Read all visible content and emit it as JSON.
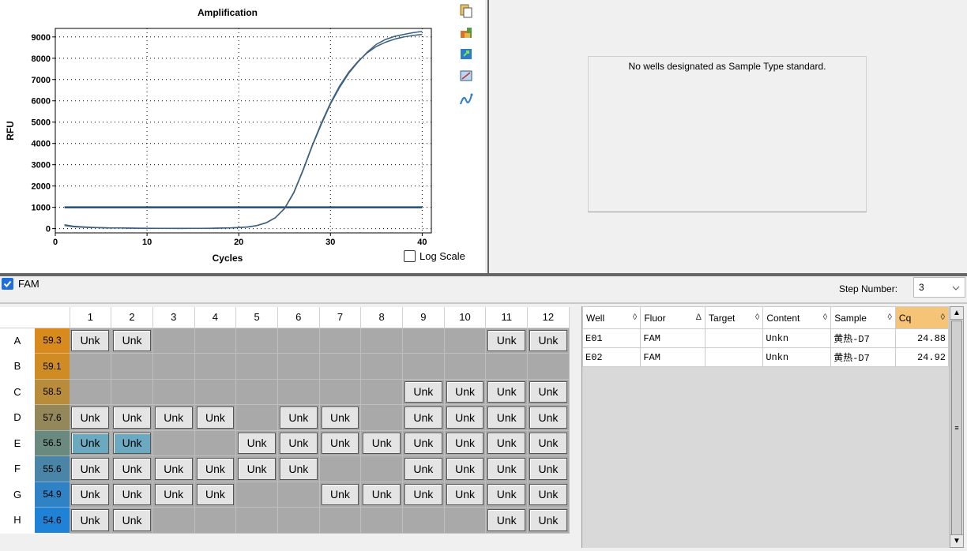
{
  "chart_data": {
    "type": "line",
    "title": "Amplification",
    "xlabel": "Cycles",
    "ylabel": "RFU",
    "xlim": [
      0,
      41
    ],
    "ylim": [
      -200,
      9400
    ],
    "xticks": [
      0,
      10,
      20,
      30,
      40
    ],
    "yticks": [
      0,
      1000,
      2000,
      3000,
      4000,
      5000,
      6000,
      7000,
      8000,
      9000
    ],
    "grid": true,
    "threshold": 1000,
    "threshold_color": "#1f4e79",
    "series_color": "#3d5f7f",
    "series": [
      {
        "x": [
          1,
          2,
          3,
          4,
          5,
          6,
          7,
          8,
          9,
          10,
          11,
          12,
          13,
          14,
          15,
          16,
          17,
          18,
          19,
          20,
          21,
          22,
          23,
          24,
          25,
          26,
          27,
          28,
          29,
          30,
          31,
          32,
          33,
          34,
          35,
          36,
          37,
          38,
          39,
          40
        ],
        "values": [
          180,
          110,
          80,
          60,
          45,
          35,
          30,
          25,
          20,
          18,
          15,
          12,
          10,
          10,
          12,
          15,
          18,
          25,
          35,
          50,
          80,
          150,
          280,
          520,
          950,
          1700,
          2750,
          3900,
          4950,
          5900,
          6700,
          7350,
          7850,
          8250,
          8550,
          8750,
          8900,
          9000,
          9070,
          9120
        ]
      },
      {
        "x": [
          1,
          2,
          3,
          4,
          5,
          6,
          7,
          8,
          9,
          10,
          11,
          12,
          13,
          14,
          15,
          16,
          17,
          18,
          19,
          20,
          21,
          22,
          23,
          24,
          25,
          26,
          27,
          28,
          29,
          30,
          31,
          32,
          33,
          34,
          35,
          36,
          37,
          38,
          39,
          40
        ],
        "values": [
          150,
          90,
          65,
          50,
          40,
          32,
          28,
          22,
          18,
          15,
          12,
          10,
          8,
          8,
          10,
          12,
          15,
          22,
          32,
          48,
          75,
          145,
          270,
          510,
          940,
          1680,
          2720,
          3870,
          4900,
          5850,
          6630,
          7300,
          7820,
          8280,
          8650,
          8880,
          9030,
          9120,
          9200,
          9260
        ]
      }
    ]
  },
  "log_scale_label": "Log Scale",
  "standard_message": "No wells designated as Sample Type standard.",
  "fluor_label": "FAM",
  "step_number_label": "Step Number:",
  "step_number_value": "3",
  "plate": {
    "columns": [
      "1",
      "2",
      "3",
      "4",
      "5",
      "6",
      "7",
      "8",
      "9",
      "10",
      "11",
      "12"
    ],
    "rows": [
      {
        "label": "A",
        "temp": "59.3",
        "temp_color": "#d98a1c",
        "wells": [
          "Unk",
          "Unk",
          "",
          "",
          "",
          "",
          "",
          "",
          "",
          "",
          "Unk",
          "Unk"
        ]
      },
      {
        "label": "B",
        "temp": "59.1",
        "temp_color": "#d08c24",
        "wells": [
          "",
          "",
          "",
          "",
          "",
          "",
          "",
          "",
          "",
          "",
          "",
          ""
        ]
      },
      {
        "label": "C",
        "temp": "58.5",
        "temp_color": "#b88c3a",
        "wells": [
          "",
          "",
          "",
          "",
          "",
          "",
          "",
          "",
          "Unk",
          "Unk",
          "Unk",
          "Unk"
        ]
      },
      {
        "label": "D",
        "temp": "57.6",
        "temp_color": "#94875a",
        "wells": [
          "Unk",
          "Unk",
          "Unk",
          "Unk",
          "",
          "Unk",
          "Unk",
          "",
          "Unk",
          "Unk",
          "Unk",
          "Unk"
        ]
      },
      {
        "label": "E",
        "temp": "56.5",
        "temp_color": "#6a8a80",
        "wells": [
          "Unk",
          "Unk",
          "",
          "",
          "Unk",
          "Unk",
          "Unk",
          "Unk",
          "Unk",
          "Unk",
          "Unk",
          "Unk"
        ]
      },
      {
        "label": "F",
        "temp": "55.6",
        "temp_color": "#4a84a6",
        "wells": [
          "Unk",
          "Unk",
          "Unk",
          "Unk",
          "Unk",
          "Unk",
          "",
          "",
          "Unk",
          "Unk",
          "Unk",
          "Unk"
        ]
      },
      {
        "label": "G",
        "temp": "54.9",
        "temp_color": "#2f82c4",
        "wells": [
          "Unk",
          "Unk",
          "Unk",
          "Unk",
          "",
          "",
          "Unk",
          "Unk",
          "Unk",
          "Unk",
          "Unk",
          "Unk"
        ]
      },
      {
        "label": "H",
        "temp": "54.6",
        "temp_color": "#1f82d6",
        "wells": [
          "Unk",
          "Unk",
          "",
          "",
          "",
          "",
          "",
          "",
          "",
          "",
          "Unk",
          "Unk"
        ]
      }
    ]
  },
  "results": {
    "headers": [
      "Well",
      "Fluor",
      "Target",
      "Content",
      "Sample",
      "Cq"
    ],
    "sort_glyphs": [
      "◊",
      "Δ",
      "◊",
      "◊",
      "◊",
      "◊"
    ],
    "rows": [
      [
        "E01",
        "FAM",
        "",
        "Unkn",
        "黄热-D7",
        "24.88"
      ],
      [
        "E02",
        "FAM",
        "",
        "Unkn",
        "黄热-D7",
        "24.92"
      ]
    ]
  }
}
